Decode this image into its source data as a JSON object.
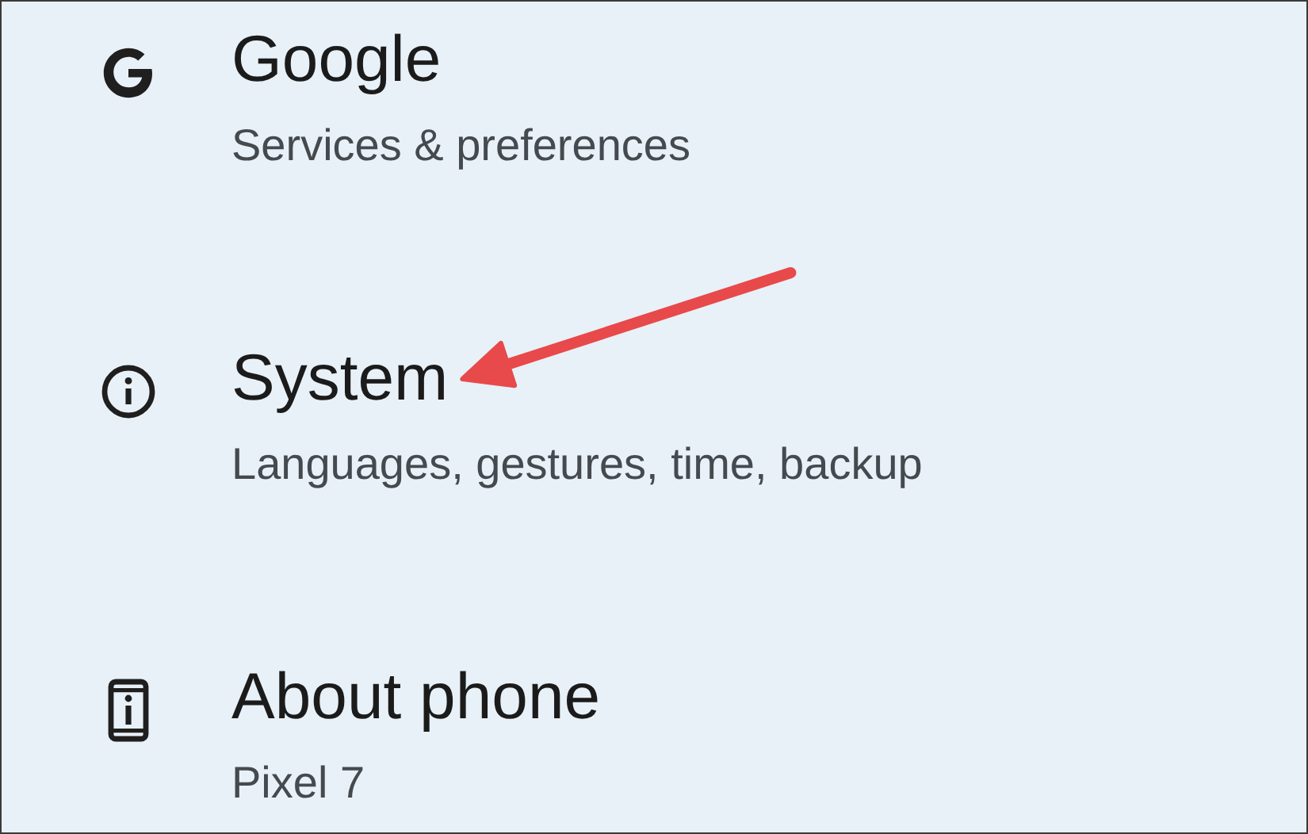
{
  "items": [
    {
      "kind": "g",
      "title": "Google",
      "subtitle": "Services & preferences",
      "arrow": false
    },
    {
      "kind": "info",
      "title": "System",
      "subtitle": "Languages, gestures, time, backup",
      "arrow": true
    },
    {
      "kind": "phone",
      "title": "About phone",
      "subtitle": "Pixel 7",
      "arrow": false
    }
  ]
}
